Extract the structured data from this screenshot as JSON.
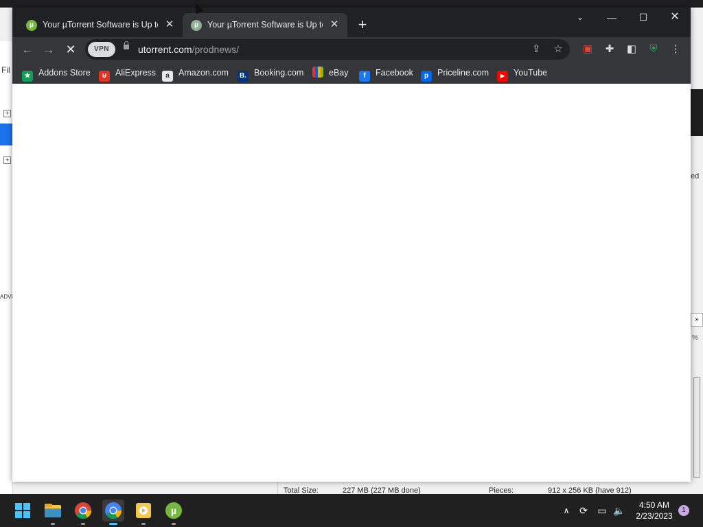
{
  "chrome": {
    "tabs": [
      {
        "title": "Your µTorrent Software is Up to Date",
        "active": false
      },
      {
        "title": "Your µTorrent Software is Up to Date",
        "active": true
      }
    ],
    "new_tab_symbol": "+",
    "url_host": "utorrent.com",
    "url_path": "/prodnews/",
    "vpn_label": "VPN",
    "bookmarks": [
      {
        "label": "Addons Store",
        "icon": "addons-store-icon",
        "color": "#0f9d58"
      },
      {
        "label": "AliExpress",
        "icon": "aliexpress-icon",
        "color": "#e43225"
      },
      {
        "label": "Amazon.com",
        "icon": "amazon-icon",
        "color": "#232f3e"
      },
      {
        "label": "Booking.com",
        "icon": "booking-icon",
        "color": "#003580"
      },
      {
        "label": "eBay",
        "icon": "ebay-icon",
        "color": "#e53238"
      },
      {
        "label": "Facebook",
        "icon": "facebook-icon",
        "color": "#1877f2"
      },
      {
        "label": "Priceline.com",
        "icon": "priceline-icon",
        "color": "#0068ef"
      },
      {
        "label": "YouTube",
        "icon": "youtube-icon",
        "color": "#ff0000"
      }
    ]
  },
  "background_app": {
    "filter_label": "Fil",
    "adv_label": "ADVE",
    "right_label": "ed",
    "percent_label": "%",
    "total_size_label": "Total Size:",
    "total_size_value": "227 MB (227 MB done)",
    "pieces_label": "Pieces:",
    "pieces_value": "912 x 256 KB (have 912)"
  },
  "taskbar": {
    "time": "4:50 AM",
    "date": "2/23/2023",
    "notification_count": "1",
    "apps": [
      "start-icon",
      "file-explorer-icon",
      "chrome-icon",
      "chrome-beta-icon",
      "media-player-icon",
      "utorrent-icon"
    ]
  }
}
